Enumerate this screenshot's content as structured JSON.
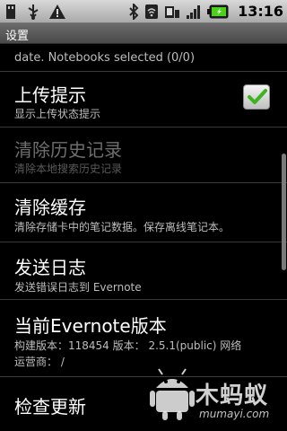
{
  "status_bar": {
    "time": "13:16",
    "left_icons": [
      "usb-storage-icon",
      "usb-debug-icon",
      "warning-icon"
    ],
    "right_icons": [
      "bluetooth-icon",
      "wifi-icon",
      "sim-icon",
      "signal-icon",
      "battery-icon"
    ]
  },
  "title_bar": {
    "title": "设置"
  },
  "list": {
    "cut_summary": "date. Notebooks selected (0/0)",
    "items": [
      {
        "title": "上传提示",
        "summary": "显示上传状态提示",
        "checked": true,
        "enabled": true
      },
      {
        "title": "清除历史记录",
        "summary": "清除本地搜索历史记录",
        "enabled": false
      },
      {
        "title": "清除缓存",
        "summary": "清除存储卡中的笔记数据。保存离线笔记本。",
        "enabled": true
      },
      {
        "title": "发送日志",
        "summary": "发送错误日志到 Evernote",
        "enabled": true
      },
      {
        "title": "当前Evernote版本",
        "summary_line1": "构建版本：118454 版本： 2.5.1(public) 网络",
        "summary_line2": "运营商： /",
        "enabled": true
      },
      {
        "title": "检查更新",
        "enabled": true
      }
    ]
  },
  "watermark": {
    "brand": "木蚂蚁",
    "url": "mumayi.com"
  },
  "colors": {
    "checkbox_check": "#3cb31f",
    "title_bar": "#555555",
    "status_bar": "#bdbdbd"
  }
}
